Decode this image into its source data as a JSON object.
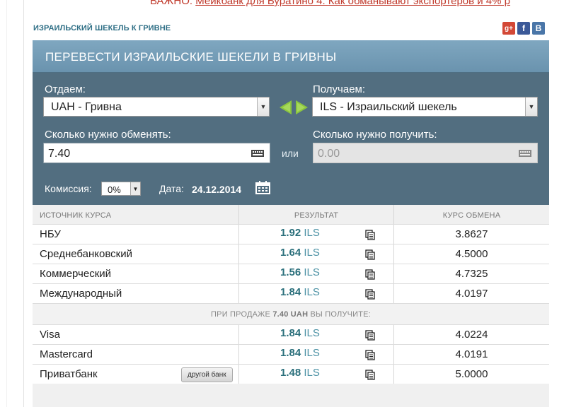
{
  "top_link": {
    "prefix": "ВАЖНО:",
    "text": "Мейкбанк для Буратино 4: Как обманывают экспортеров и 4% р"
  },
  "breadcrumb": "ИЗРАИЛЬСКИЙ ШЕКЕЛЬ К ГРИВНЕ",
  "share": {
    "google": "g+",
    "facebook": "f",
    "vk": "В"
  },
  "converter": {
    "title": "ПЕРЕВЕСТИ ИЗРАИЛЬСКИЕ ШЕКЕЛИ В ГРИВНЫ",
    "give_label": "Отдаем:",
    "give_value": "UAH - Гривна",
    "get_label": "Получаем:",
    "get_value": "ILS - Израильский шекель",
    "amount_label": "Сколько нужно обменять:",
    "amount_value": "7.40",
    "or_label": "или",
    "receive_label": "Сколько нужно получить:",
    "receive_placeholder": "0.00",
    "commission_label": "Комиссия:",
    "commission_value": "0%",
    "date_label": "Дата:",
    "date_value": "24.12.2014"
  },
  "table": {
    "headers": [
      "ИСТОЧНИК КУРСА",
      "РЕЗУЛЬТАТ",
      "КУРС ОБМЕНА"
    ],
    "currency": "ILS",
    "rows": [
      {
        "source": "НБУ",
        "result": "1.92",
        "rate": "3.8627"
      },
      {
        "source": "Среднебанковский",
        "result": "1.64",
        "rate": "4.5000"
      },
      {
        "source": "Коммерческий",
        "result": "1.56",
        "rate": "4.7325"
      },
      {
        "source": "Международный",
        "result": "1.84",
        "rate": "4.0197"
      }
    ],
    "sell_note": {
      "prefix": "ПРИ ПРОДАЖЕ",
      "amount": "7.40 UAH",
      "suffix": "ВЫ ПОЛУЧИТЕ:"
    },
    "card_rows": [
      {
        "source": "Visa",
        "result": "1.84",
        "rate": "4.0224"
      },
      {
        "source": "Mastercard",
        "result": "1.84",
        "rate": "4.0191"
      },
      {
        "source": "Приватбанк",
        "result": "1.48",
        "rate": "5.0000"
      }
    ],
    "other_bank_label": "другой банк"
  }
}
